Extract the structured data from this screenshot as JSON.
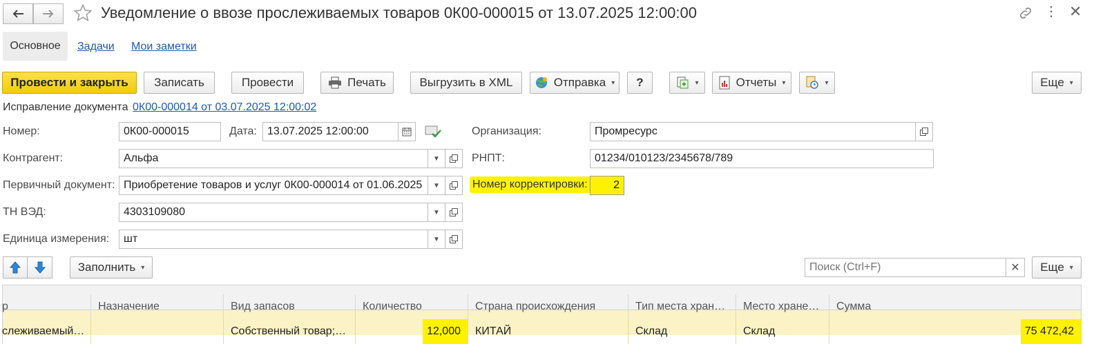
{
  "window": {
    "title": "Уведомление о ввозе прослеживаемых товаров 0К00-000015 от 13.07.2025 12:00:00"
  },
  "tabs": [
    {
      "label": "Основное"
    },
    {
      "label": "Задачи"
    },
    {
      "label": "Мои заметки"
    }
  ],
  "toolbar": {
    "post_close": "Провести и закрыть",
    "save": "Записать",
    "post": "Провести",
    "print": "Печать",
    "export_xml": "Выгрузить в XML",
    "send": "Отправка",
    "help": "?",
    "reports": "Отчеты",
    "more": "Еще"
  },
  "correction": {
    "label": "Исправление документа",
    "link": "0К00-000014 от 03.07.2025 12:00:02"
  },
  "form": {
    "number_label": "Номер:",
    "number_value": "0К00-000015",
    "date_label": "Дата:",
    "date_value": "13.07.2025 12:00:00",
    "org_label": "Организация:",
    "org_value": "Промресурс",
    "contractor_label": "Контрагент:",
    "contractor_value": "Альфа",
    "rnpt_label": "РНПТ:",
    "rnpt_value": "01234/010123/2345678/789",
    "primary_doc_label": "Первичный документ:",
    "primary_doc_value": "Приобретение товаров и услуг 0К00-000014 от 01.06.2025",
    "correction_number_label": "Номер корректировки:",
    "correction_number_value": "2",
    "tnved_label": "ТН ВЭД:",
    "tnved_value": "4303109080",
    "unit_label": "Единица измерения:",
    "unit_value": "шт"
  },
  "table_toolbar": {
    "fill": "Заполнить",
    "search_placeholder": "Поиск (Ctrl+F)",
    "more": "Еще"
  },
  "table": {
    "columns": [
      "р",
      "Назначение",
      "Вид запасов",
      "Количество",
      "Страна происхождения",
      "Тип места хран…",
      "Место хране…",
      "Сумма"
    ],
    "rows": [
      [
        "слеживаемый…",
        "",
        "Собственный товар;…",
        "12,000",
        "КИТАЙ",
        "Склад",
        "Склад",
        "75 472,42"
      ]
    ]
  },
  "colors": {
    "primary_button": "#f7d117",
    "highlight": "#fff200",
    "selected_row": "#fbf3c6",
    "link": "#1e5aa8"
  }
}
